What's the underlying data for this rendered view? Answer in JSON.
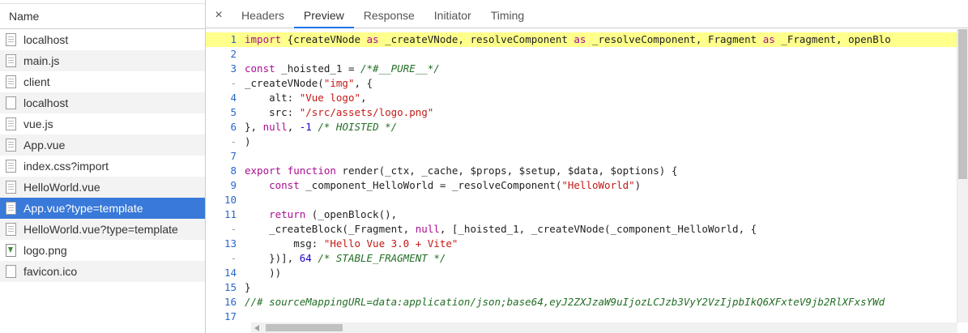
{
  "network": {
    "name_header": "Name",
    "files": [
      {
        "name": "localhost",
        "icon": "document-icon"
      },
      {
        "name": "main.js",
        "icon": "document-icon"
      },
      {
        "name": "client",
        "icon": "document-icon"
      },
      {
        "name": "localhost",
        "icon": "blank-file-icon"
      },
      {
        "name": "vue.js",
        "icon": "document-icon"
      },
      {
        "name": "App.vue",
        "icon": "document-icon"
      },
      {
        "name": "index.css?import",
        "icon": "document-icon"
      },
      {
        "name": "HelloWorld.vue",
        "icon": "document-icon"
      },
      {
        "name": "App.vue?type=template",
        "icon": "document-icon",
        "selected": true
      },
      {
        "name": "HelloWorld.vue?type=template",
        "icon": "document-icon"
      },
      {
        "name": "logo.png",
        "icon": "image-file-icon"
      },
      {
        "name": "favicon.ico",
        "icon": "blank-file-icon"
      }
    ]
  },
  "detail": {
    "close_glyph": "×",
    "tabs": [
      "Headers",
      "Preview",
      "Response",
      "Initiator",
      "Timing"
    ],
    "active_tab": "Preview"
  },
  "code": {
    "lines": [
      {
        "n": "1",
        "hl": true,
        "text": "import {createVNode as _createVNode, resolveComponent as _resolveComponent, Fragment as _Fragment, openBlo"
      },
      {
        "n": "2",
        "text": ""
      },
      {
        "n": "3",
        "text": "const _hoisted_1 = /*#__PURE__*/"
      },
      {
        "n": "-",
        "text": "_createVNode(\"img\", {"
      },
      {
        "n": "4",
        "text": "    alt: \"Vue logo\","
      },
      {
        "n": "5",
        "text": "    src: \"/src/assets/logo.png\""
      },
      {
        "n": "6",
        "text": "}, null, -1 /* HOISTED */"
      },
      {
        "n": "-",
        "text": ")"
      },
      {
        "n": "7",
        "text": ""
      },
      {
        "n": "8",
        "text": "export function render(_ctx, _cache, $props, $setup, $data, $options) {"
      },
      {
        "n": "9",
        "text": "    const _component_HelloWorld = _resolveComponent(\"HelloWorld\")"
      },
      {
        "n": "10",
        "text": ""
      },
      {
        "n": "11",
        "text": "    return (_openBlock(),"
      },
      {
        "n": "-",
        "text": "    _createBlock(_Fragment, null, [_hoisted_1, _createVNode(_component_HelloWorld, {"
      },
      {
        "n": "13",
        "text": "        msg: \"Hello Vue 3.0 + Vite\""
      },
      {
        "n": "-",
        "text": "    })], 64 /* STABLE_FRAGMENT */"
      },
      {
        "n": "14",
        "text": "    ))"
      },
      {
        "n": "15",
        "text": "}"
      },
      {
        "n": "16",
        "text": "//# sourceMappingURL=data:application/json;base64,eyJ2ZXJzaW9uIjozLCJzb3VyY2VzIjpbIkQ6XFxteV9jb2RlXFxsYWd"
      },
      {
        "n": "17",
        "text": ""
      }
    ]
  },
  "colors": {
    "selected_row": "#3879d9",
    "active_tab_underline": "#1a73e8",
    "highlight_line": "#ffff8c"
  }
}
